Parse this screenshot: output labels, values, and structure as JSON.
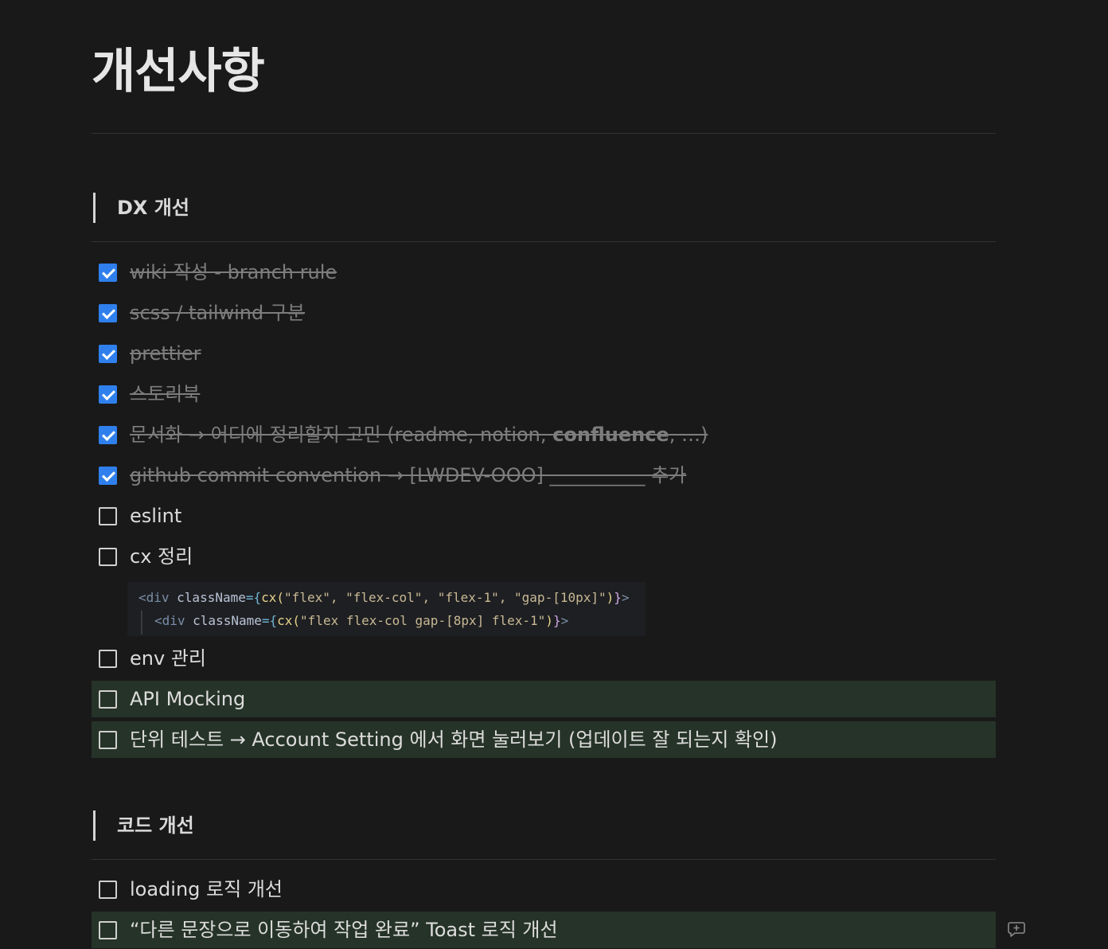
{
  "page": {
    "title": "개선사항"
  },
  "sections": {
    "dx": {
      "heading": "DX 개선",
      "items": [
        {
          "text": "wiki 작성 - branch rule",
          "checked": true
        },
        {
          "text": "scss / tailwind 구분",
          "checked": true
        },
        {
          "text": "prettier",
          "checked": true
        },
        {
          "text": "스토리북",
          "checked": true
        },
        {
          "text_before": "문서화 → 어디에 정리할지 고민 (readme, notion, ",
          "text_bold": "confluence",
          "text_after": ", …)",
          "checked": true
        },
        {
          "text": "github commit convention → [LWDEV-OOO] __________ 추가",
          "checked": true
        },
        {
          "text": "eslint",
          "checked": false
        },
        {
          "text": "cx 정리",
          "checked": false
        },
        {
          "text": "env 관리",
          "checked": false
        },
        {
          "text": "API Mocking",
          "checked": false,
          "highlighted": true
        },
        {
          "text": "단위 테스트 → Account Setting 에서 화면 눌러보기 (업데이트 잘 되는지 확인)",
          "checked": false,
          "highlighted": true
        }
      ]
    },
    "code": {
      "heading": "코드 개선",
      "items": [
        {
          "text": "loading 로직 개선",
          "checked": false
        },
        {
          "text": "“다른 문장으로 이동하여 작업 완료” Toast 로직 개선",
          "checked": false,
          "highlighted": true
        }
      ]
    }
  },
  "code_snippet": {
    "line1": {
      "tag_open": "<div",
      "attr": " className",
      "eq": "=",
      "brace_open": "{",
      "fn": "cx(",
      "args": "\"flex\", \"flex-col\", \"flex-1\", \"gap-[10px]\"",
      "paren_close": ")",
      "brace_close": "}",
      "tag_close": ">"
    },
    "line2": {
      "tag_open": "<div",
      "attr": " className",
      "eq": "=",
      "brace_open": "{",
      "fn": "cx(",
      "args": "\"flex flex-col gap-[8px] flex-1\"",
      "paren_close": ")",
      "brace_close": "}",
      "tag_close": ">"
    }
  },
  "colors": {
    "background": "#191919",
    "checkbox_checked": "#2f80ed",
    "highlight_row": "#263328"
  },
  "icons": {
    "comment": "add-comment-icon"
  }
}
